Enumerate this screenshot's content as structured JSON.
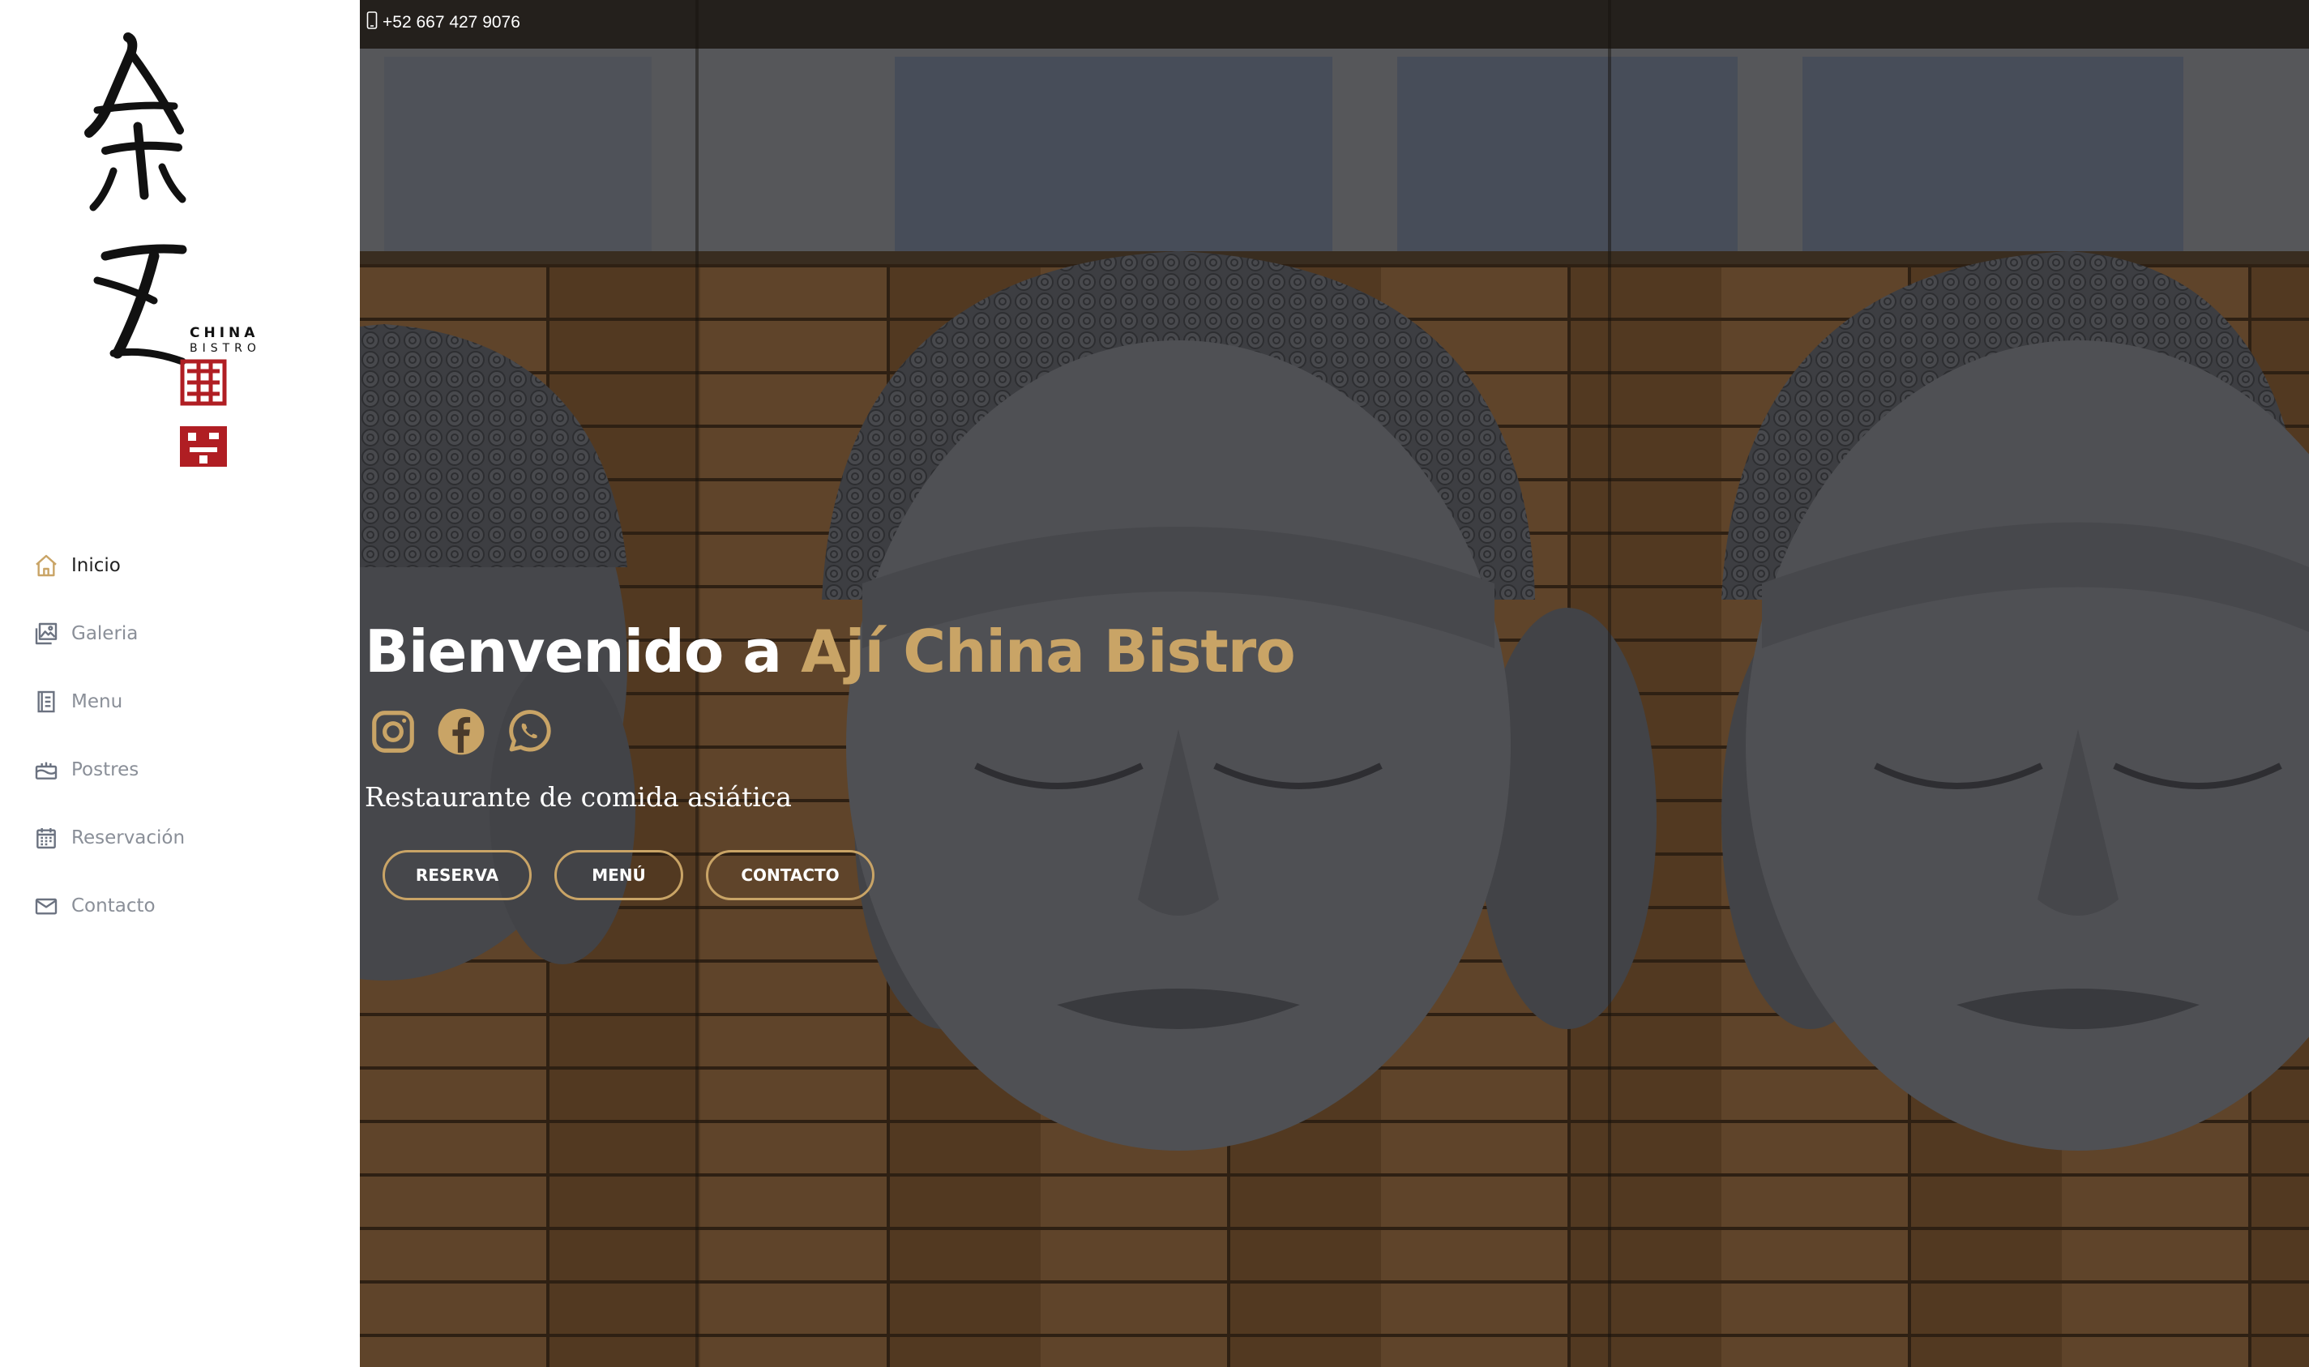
{
  "logo": {
    "brand_line1": "CHINA",
    "brand_line2": "BISTRO"
  },
  "nav": {
    "items": [
      {
        "label": "Inicio",
        "icon": "home-icon",
        "active": true
      },
      {
        "label": "Galeria",
        "icon": "gallery-icon",
        "active": false
      },
      {
        "label": "Menu",
        "icon": "menu-book-icon",
        "active": false
      },
      {
        "label": "Postres",
        "icon": "dessert-icon",
        "active": false
      },
      {
        "label": "Reservación",
        "icon": "calendar-icon",
        "active": false
      },
      {
        "label": "Contacto",
        "icon": "envelope-icon",
        "active": false
      }
    ]
  },
  "topbar": {
    "phone": "+52 667 427 9076",
    "phone_icon": "mobile-phone-icon"
  },
  "hero": {
    "title_prefix": "Bienvenido a ",
    "title_brand": "Ají China Bistro",
    "tagline": "Restaurante de comida asiática",
    "socials": [
      "instagram-icon",
      "facebook-icon",
      "whatsapp-icon"
    ],
    "buttons": {
      "reserva": "RESERVA",
      "menu": "MENÚ",
      "contacto": "CONTACTO"
    }
  },
  "colors": {
    "accent": "#c9a466",
    "nav_text": "#8a8f98",
    "nav_active": "#222222",
    "seal_red": "#b01e23"
  }
}
